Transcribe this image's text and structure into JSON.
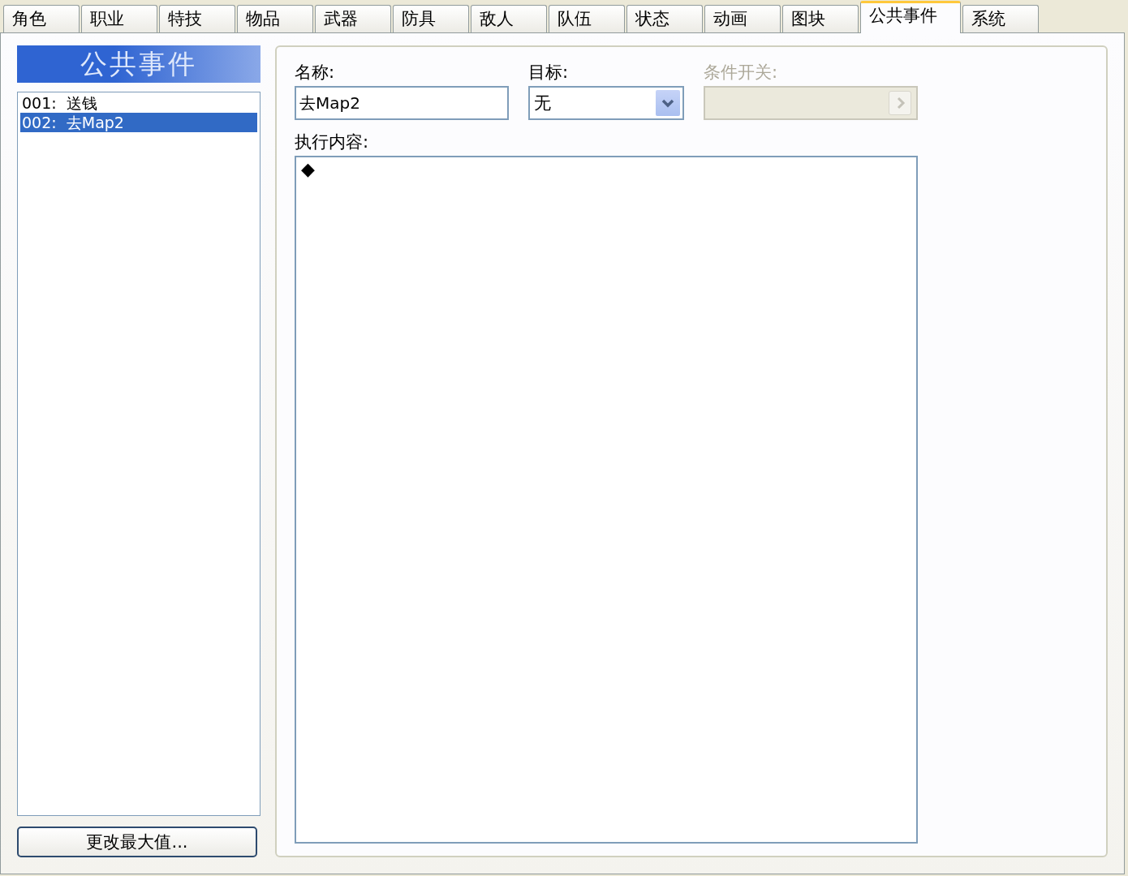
{
  "tabs": [
    {
      "label": "角色",
      "selected": false
    },
    {
      "label": "职业",
      "selected": false
    },
    {
      "label": "特技",
      "selected": false
    },
    {
      "label": "物品",
      "selected": false
    },
    {
      "label": "武器",
      "selected": false
    },
    {
      "label": "防具",
      "selected": false
    },
    {
      "label": "敌人",
      "selected": false
    },
    {
      "label": "队伍",
      "selected": false
    },
    {
      "label": "状态",
      "selected": false
    },
    {
      "label": "动画",
      "selected": false
    },
    {
      "label": "图块",
      "selected": false
    },
    {
      "label": "公共事件",
      "selected": true
    },
    {
      "label": "系统",
      "selected": false
    }
  ],
  "event_list": {
    "title": "公共事件",
    "items": [
      {
        "label": "001:  送钱",
        "selected": false
      },
      {
        "label": "002:  去Map2",
        "selected": true
      }
    ],
    "button": "更改最大值..."
  },
  "form": {
    "name": {
      "label": "名称:",
      "value": "去Map2"
    },
    "target": {
      "label": "目标:",
      "value": "无"
    },
    "switch": {
      "label": "条件开关:",
      "disabled": true
    },
    "contents": {
      "label": "执行内容:",
      "lines": [
        "◆"
      ]
    }
  }
}
